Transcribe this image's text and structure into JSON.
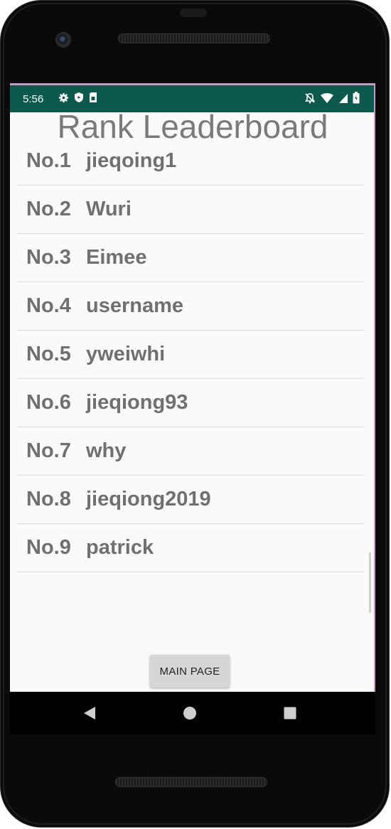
{
  "status_bar": {
    "time": "5:56",
    "icons_left": [
      "settings-icon",
      "shield-icon",
      "sim-card-icon"
    ],
    "icons_right": [
      "notifications-off-icon",
      "wifi-icon",
      "signal-icon",
      "battery-icon"
    ],
    "color": "#0b5a4c"
  },
  "page": {
    "title": "Rank Leaderboard"
  },
  "leaderboard": {
    "rows": [
      {
        "rank": "No.1",
        "name": "jieqoing1"
      },
      {
        "rank": "No.2",
        "name": "Wuri"
      },
      {
        "rank": "No.3",
        "name": "Eimee"
      },
      {
        "rank": "No.4",
        "name": "username"
      },
      {
        "rank": "No.5",
        "name": "yweiwhi"
      },
      {
        "rank": "No.6",
        "name": "jieqiong93"
      },
      {
        "rank": "No.7",
        "name": "why"
      },
      {
        "rank": "No.8",
        "name": "jieqiong2019"
      },
      {
        "rank": "No.9",
        "name": "patrick"
      }
    ]
  },
  "footer": {
    "main_page_label": "MAIN PAGE"
  },
  "nav_bar": {
    "icons": [
      "back-icon",
      "home-icon",
      "recents-icon"
    ]
  }
}
